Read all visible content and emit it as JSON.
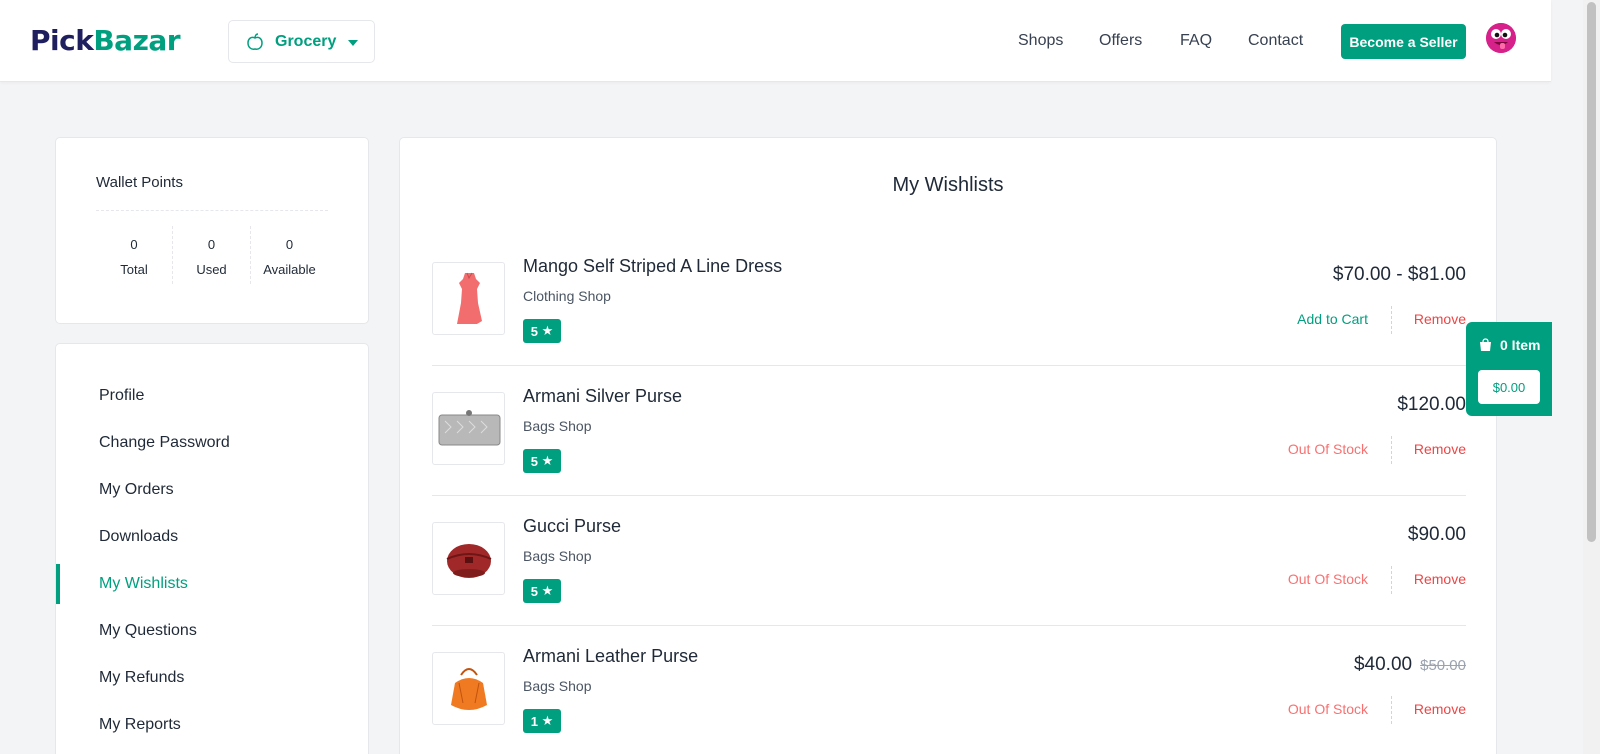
{
  "header": {
    "logo_part1": "Pick",
    "logo_part2": "Bazar",
    "group": "Grocery",
    "nav": {
      "shops": "Shops",
      "offers": "Offers",
      "faq": "FAQ",
      "contact": "Contact"
    },
    "become_seller": "Become a Seller"
  },
  "wallet": {
    "title": "Wallet Points",
    "columns": [
      {
        "value": "0",
        "label": "Total"
      },
      {
        "value": "0",
        "label": "Used"
      },
      {
        "value": "0",
        "label": "Available"
      }
    ]
  },
  "sidebar": {
    "items": [
      {
        "label": "Profile"
      },
      {
        "label": "Change Password"
      },
      {
        "label": "My Orders"
      },
      {
        "label": "Downloads"
      },
      {
        "label": "My Wishlists",
        "active": true
      },
      {
        "label": "My Questions"
      },
      {
        "label": "My Refunds"
      },
      {
        "label": "My Reports"
      }
    ]
  },
  "main": {
    "title": "My Wishlists",
    "items": [
      {
        "name": "Mango Self Striped A Line Dress",
        "shop": "Clothing Shop",
        "rating": "5",
        "price": "$70.00 - $81.00",
        "old_price": "",
        "action": "Add to Cart",
        "remove": "Remove",
        "icon": "dress-image"
      },
      {
        "name": "Armani Silver Purse",
        "shop": "Bags Shop",
        "rating": "5",
        "price": "$120.00",
        "old_price": "",
        "action": "Out Of Stock",
        "remove": "Remove",
        "icon": "silver-purse-image"
      },
      {
        "name": "Gucci Purse",
        "shop": "Bags Shop",
        "rating": "5",
        "price": "$90.00",
        "old_price": "",
        "action": "Out Of Stock",
        "remove": "Remove",
        "icon": "red-purse-image"
      },
      {
        "name": "Armani Leather Purse",
        "shop": "Bags Shop",
        "rating": "1",
        "price": "$40.00",
        "old_price": "$50.00",
        "action": "Out Of Stock",
        "remove": "Remove",
        "icon": "orange-bag-image"
      }
    ]
  },
  "cart": {
    "count": "0 Item",
    "amount": "$0.00"
  },
  "colors": {
    "accent": "#009f7f",
    "logo_dark": "#1f1e5e",
    "danger": "#ef4444",
    "out_of_stock": "#f87171",
    "background": "#f3f4f6"
  }
}
